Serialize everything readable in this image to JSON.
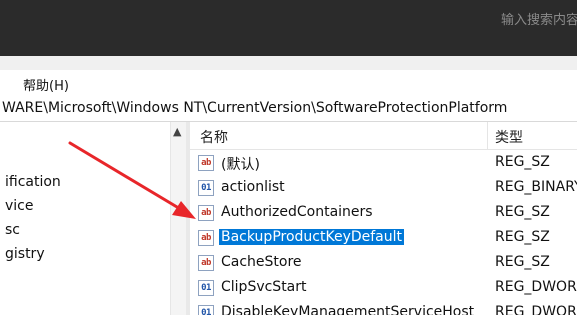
{
  "topbar": {
    "search_hint": "输入搜索内容"
  },
  "menu": {
    "help": "帮助(H)"
  },
  "address": {
    "path": "WARE\\Microsoft\\Windows NT\\CurrentVersion\\SoftwareProtectionPlatform"
  },
  "tree": {
    "items": [
      {
        "label": "ification"
      },
      {
        "label": "vice"
      },
      {
        "label": "sc"
      },
      {
        "label": "gistry"
      }
    ]
  },
  "list": {
    "headers": {
      "name": "名称",
      "type": "类型"
    },
    "rows": [
      {
        "name": "(默认)",
        "type": "REG_SZ",
        "icon": "string-value-icon"
      },
      {
        "name": "actionlist",
        "type": "REG_BINARY",
        "icon": "binary-value-icon"
      },
      {
        "name": "AuthorizedContainers",
        "type": "REG_SZ",
        "icon": "string-value-icon"
      },
      {
        "name": "BackupProductKeyDefault",
        "type": "REG_SZ",
        "icon": "string-value-icon",
        "selected": true
      },
      {
        "name": "CacheStore",
        "type": "REG_SZ",
        "icon": "string-value-icon"
      },
      {
        "name": "ClipSvcStart",
        "type": "REG_DWORD",
        "icon": "binary-value-icon"
      },
      {
        "name": "DisableKeyManagementServiceHost",
        "type": "REG_DWORD",
        "icon": "binary-value-icon"
      }
    ]
  },
  "colors": {
    "selection": "#0078d7",
    "arrow": "#e8262a"
  }
}
